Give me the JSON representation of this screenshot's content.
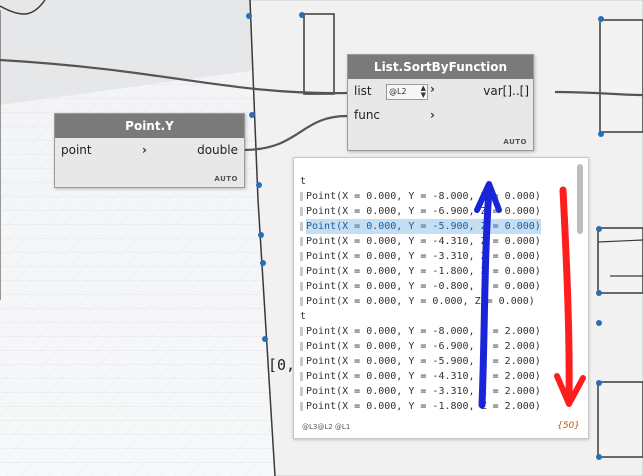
{
  "nodes": {
    "sort": {
      "title": "List.SortByFunction",
      "inputs": [
        {
          "label": "list"
        },
        {
          "label": "func"
        }
      ],
      "list_level": "@L2",
      "output": "var[]..[]",
      "footer": "AUTO"
    },
    "pointy": {
      "title": "Point.Y",
      "input": "point",
      "output": "double",
      "footer": "AUTO"
    }
  },
  "preview": {
    "lines": [
      {
        "text": "t",
        "sub": false,
        "hl": false
      },
      {
        "text": "Point(X = 0.000, Y = -8.000, Z = 0.000)",
        "sub": true,
        "hl": false
      },
      {
        "text": "Point(X = 0.000, Y = -6.900, Z = 0.000)",
        "sub": true,
        "hl": false
      },
      {
        "text": "Point(X = 0.000, Y = -5.900, Z = 0.000)",
        "sub": true,
        "hl": true
      },
      {
        "text": "Point(X = 0.000, Y = -4.310, Z = 0.000)",
        "sub": true,
        "hl": false
      },
      {
        "text": "Point(X = 0.000, Y = -3.310, Z = 0.000)",
        "sub": true,
        "hl": false
      },
      {
        "text": "Point(X = 0.000, Y = -1.800, Z = 0.000)",
        "sub": true,
        "hl": false
      },
      {
        "text": "Point(X = 0.000, Y = -0.800, Z = 0.000)",
        "sub": true,
        "hl": false
      },
      {
        "text": "Point(X = 0.000, Y = 0.000, Z = 0.000)",
        "sub": true,
        "hl": false
      },
      {
        "text": "t",
        "sub": false,
        "hl": false
      },
      {
        "text": "Point(X = 0.000, Y = -8.000, Z = 2.000)",
        "sub": true,
        "hl": false
      },
      {
        "text": "Point(X = 0.000, Y = -6.900, Z = 2.000)",
        "sub": true,
        "hl": false
      },
      {
        "text": "Point(X = 0.000, Y = -5.900, Z = 2.000)",
        "sub": true,
        "hl": false
      },
      {
        "text": "Point(X = 0.000, Y = -4.310, Z = 2.000)",
        "sub": true,
        "hl": false
      },
      {
        "text": "Point(X = 0.000, Y = -3.310, Z = 2.000)",
        "sub": true,
        "hl": false
      },
      {
        "text": "Point(X = 0.000, Y = -1.800, Z = 2.000)",
        "sub": true,
        "hl": false
      }
    ],
    "levels": "@L3@L2 @L1",
    "count": "{50}"
  },
  "canvas_label": "[0,",
  "colors": {
    "node_header": "#7a7a7a",
    "node_body": "#e8e8e8",
    "highlight": "#c6def2",
    "annotation_blue": "#1a24d8",
    "annotation_red": "#ff1e1e",
    "grid_point": "#2a6fb3"
  }
}
